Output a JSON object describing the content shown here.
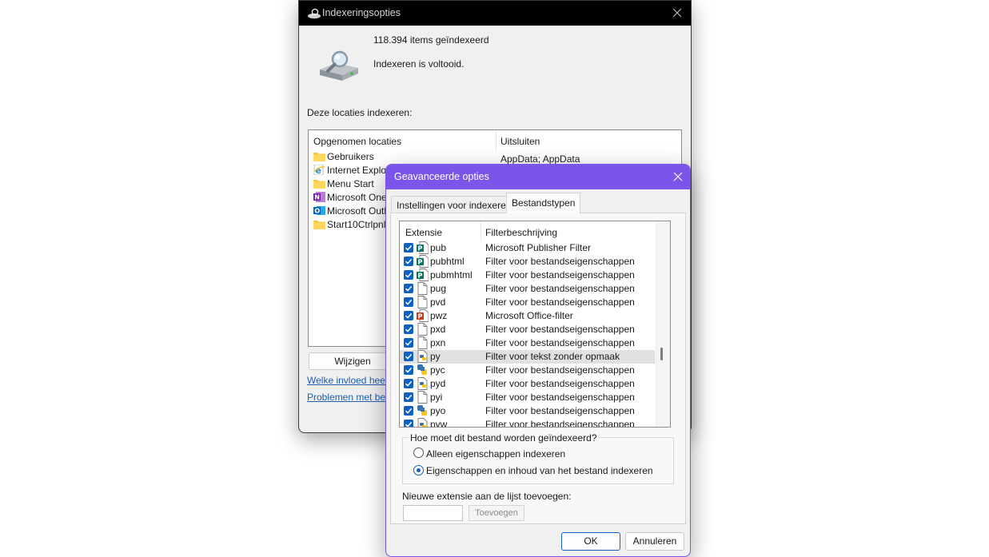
{
  "main_window": {
    "title": "Indexeringsopties",
    "items_indexed": "118.394 items geïndexeerd",
    "status": "Indexeren is voltooid.",
    "locations_label": "Deze locaties indexeren:",
    "columns": {
      "included": "Opgenomen locaties",
      "exclude": "Uitsluiten"
    },
    "locations": [
      {
        "name": "Gebruikers",
        "icon": "folder-icon"
      },
      {
        "name": "Internet Explor",
        "icon": "internet-explorer-icon"
      },
      {
        "name": "Menu Start",
        "icon": "folder-icon"
      },
      {
        "name": "Microsoft OneN",
        "icon": "onenote-icon"
      },
      {
        "name": "Microsoft Outlo",
        "icon": "outlook-icon"
      },
      {
        "name": "Start10Ctrlpnl",
        "icon": "folder-icon"
      }
    ],
    "exclude_first": "AppData; AppData",
    "modify_button": "Wijzigen",
    "link_influence": "Welke invloed heeft",
    "link_problems": "Problemen met betre"
  },
  "advanced_dialog": {
    "title": "Geavanceerde opties",
    "tabs": [
      "Instellingen voor indexeren",
      "Bestandstypen"
    ],
    "active_tab": "Bestandstypen",
    "columns": {
      "extension": "Extensie",
      "filter": "Filterbeschrijving"
    },
    "filetypes": [
      {
        "ext": "pub",
        "desc": "Microsoft Publisher Filter",
        "checked": true,
        "icon": "publisher-icon"
      },
      {
        "ext": "pubhtml",
        "desc": "Filter voor bestandseigenschappen",
        "checked": true,
        "icon": "publisher-icon"
      },
      {
        "ext": "pubmhtml",
        "desc": "Filter voor bestandseigenschappen",
        "checked": true,
        "icon": "publisher-icon"
      },
      {
        "ext": "pug",
        "desc": "Filter voor bestandseigenschappen",
        "checked": true,
        "icon": "file-icon"
      },
      {
        "ext": "pvd",
        "desc": "Filter voor bestandseigenschappen",
        "checked": true,
        "icon": "file-icon"
      },
      {
        "ext": "pwz",
        "desc": "Microsoft Office-filter",
        "checked": true,
        "icon": "powerpoint-icon"
      },
      {
        "ext": "pxd",
        "desc": "Filter voor bestandseigenschappen",
        "checked": true,
        "icon": "file-icon"
      },
      {
        "ext": "pxn",
        "desc": "Filter voor bestandseigenschappen",
        "checked": true,
        "icon": "file-icon"
      },
      {
        "ext": "py",
        "desc": "Filter voor tekst zonder opmaak",
        "checked": true,
        "icon": "python-file-icon",
        "selected": true
      },
      {
        "ext": "pyc",
        "desc": "Filter voor bestandseigenschappen",
        "checked": true,
        "icon": "python-icon"
      },
      {
        "ext": "pyd",
        "desc": "Filter voor bestandseigenschappen",
        "checked": true,
        "icon": "python-file-icon"
      },
      {
        "ext": "pyi",
        "desc": "Filter voor bestandseigenschappen",
        "checked": true,
        "icon": "file-icon"
      },
      {
        "ext": "pyo",
        "desc": "Filter voor bestandseigenschappen",
        "checked": true,
        "icon": "python-icon"
      },
      {
        "ext": "pyw",
        "desc": "Filter voor bestandseigenschappen",
        "checked": true,
        "icon": "python-file-icon"
      }
    ],
    "index_question": "Hoe moet dit bestand worden geïndexeerd?",
    "option_properties": "Alleen eigenschappen indexeren",
    "option_contents": "Eigenschappen en inhoud van het bestand indexeren",
    "selected_option": "option_contents",
    "new_ext_label": "Nieuwe extensie aan de lijst toevoegen:",
    "new_ext_value": "",
    "add_button": "Toevoegen",
    "ok_button": "OK",
    "cancel_button": "Annuleren"
  },
  "colors": {
    "accent": "#7b55e9",
    "checkbox": "#0f61bf",
    "link": "#1a5fb4"
  }
}
